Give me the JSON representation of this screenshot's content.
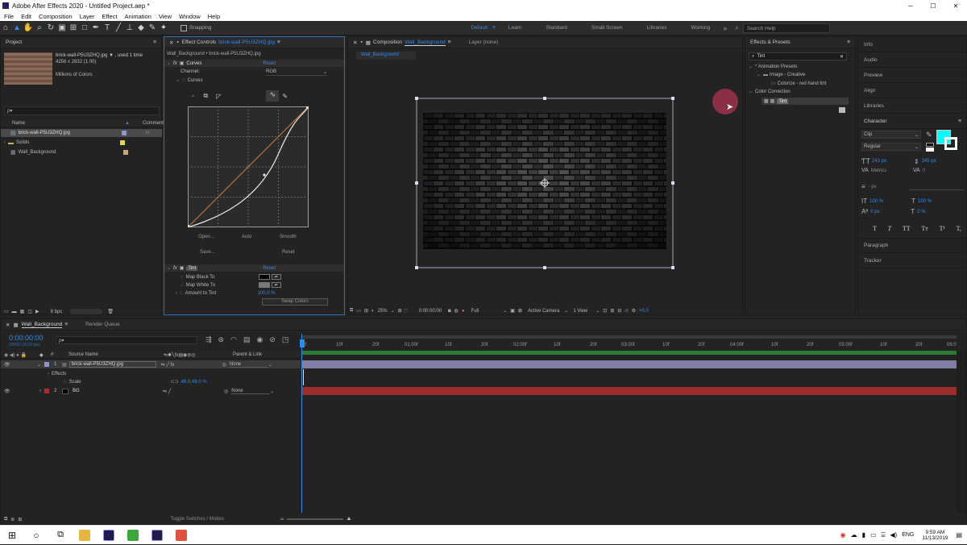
{
  "window": {
    "title": "Adobe After Effects 2020 - Untitled Project.aep *",
    "min": "─",
    "max": "☐",
    "close": "✕"
  },
  "menu": [
    "File",
    "Edit",
    "Composition",
    "Layer",
    "Effect",
    "Animation",
    "View",
    "Window",
    "Help"
  ],
  "toolbar": {
    "snapping": "Snapping",
    "workspaces": [
      "Default",
      "Learn",
      "Standard",
      "Small Screen",
      "Libraries",
      "Working"
    ],
    "search_placeholder": "Search Help"
  },
  "project": {
    "title": "Project",
    "item_name": "brick-wall-P5U3ZHQ.jpg ▼ , used 1 time",
    "item_size": "4256 x 2832 (1.00)",
    "item_colors": "Millions of Colors",
    "search_placeholder": "ρ▾",
    "col_name": "Name",
    "col_comment": "Comment",
    "items": [
      {
        "name": "brick-wall-P5U3ZHQ.jpg",
        "color": "#8e95c8"
      },
      {
        "name": "Solids",
        "color": "#e1d94b"
      },
      {
        "name": "Wall_Background",
        "color": "#c7a77a"
      }
    ],
    "bpc": "8 bpc"
  },
  "effect_controls": {
    "title": "Effect Controls",
    "title_file": "brick-wall-P5U3ZHQ.jpg",
    "layer_path": "Wall_Background • brick-wall-P5U3ZHQ.jpg",
    "curves": {
      "name": "Curves",
      "reset": "Reset",
      "channel_label": "Channel:",
      "channel_value": "RGB",
      "curves_label": "Curves",
      "open": "Open...",
      "auto": "Auto",
      "smooth": "Smooth",
      "save": "Save...",
      "reset2": "Reset"
    },
    "tint": {
      "name": "Tint",
      "reset": "Reset",
      "map_black": "Map Black To",
      "map_white": "Map White To",
      "amount_label": "Amount to Tint",
      "amount_value": "100.0 %",
      "swap": "Swap Colors",
      "black_color": "#000000",
      "white_color": "#7a7a7a"
    }
  },
  "composition": {
    "title": "Composition",
    "comp_name": "Wall_Background",
    "layer_tab": "Layer (none)",
    "sub_tab": "Wall_Background",
    "zoom": "25%",
    "timecode": "0:00:00:00",
    "resolution": "Full",
    "camera": "Active Camera",
    "views": "1 View",
    "offset": "+0.0"
  },
  "effects_presets": {
    "title": "Effects & Presets",
    "search": "Tint",
    "tree": [
      "* Animation Presets",
      "Image - Creative",
      "Colorize - red hand tint",
      "Color Correction",
      "Tint"
    ]
  },
  "right_tabs": [
    "Info",
    "Audio",
    "Preview",
    "Align",
    "Libraries"
  ],
  "character": {
    "title": "Character",
    "font": "Clip",
    "style": "Regular",
    "size": "243 px",
    "leading": "245 px",
    "kerning": "Metrics",
    "tracking": "0",
    "stroke": "- px",
    "vscale": "100 %",
    "hscale": "100 %",
    "baseline": "0 px",
    "tsume": "0 %",
    "styles": [
      "T",
      "T",
      "TT",
      "Tт",
      "T¹",
      "T,"
    ],
    "fill_color": "#00ffff"
  },
  "bottom_tabs": [
    "Paragraph",
    "Tracker"
  ],
  "timeline": {
    "tab": "Wall_Background",
    "render_queue": "Render Queue",
    "timecode": "0:00:00:00",
    "fps": "00000 (30.00 fps)",
    "search_placeholder": "ρ▾",
    "col_source": "Source Name",
    "col_parent": "Parent & Link",
    "layers": [
      {
        "num": "1",
        "name": "brick-wall-P5U3ZHQ.jpg",
        "parent": "None",
        "color": "#8e95c8"
      },
      {
        "num": "2",
        "name": "BG",
        "parent": "None",
        "color": "#b22b2b"
      }
    ],
    "effects_label": "Effects",
    "scale_label": "Scale",
    "scale_value": "48.0,48.0 %",
    "ruler": [
      "0f",
      "10f",
      "20f",
      "01:00f",
      "10f",
      "20f",
      "02:00f",
      "10f",
      "20f",
      "03:00f",
      "10f",
      "20f",
      "04:00f",
      "10f",
      "20f",
      "05:00f",
      "10f",
      "20f",
      "06:0"
    ],
    "toggle": "Toggle Switches / Modes"
  },
  "taskbar": {
    "time": "9:59 AM",
    "date": "11/13/2019",
    "lang": "ENG"
  }
}
